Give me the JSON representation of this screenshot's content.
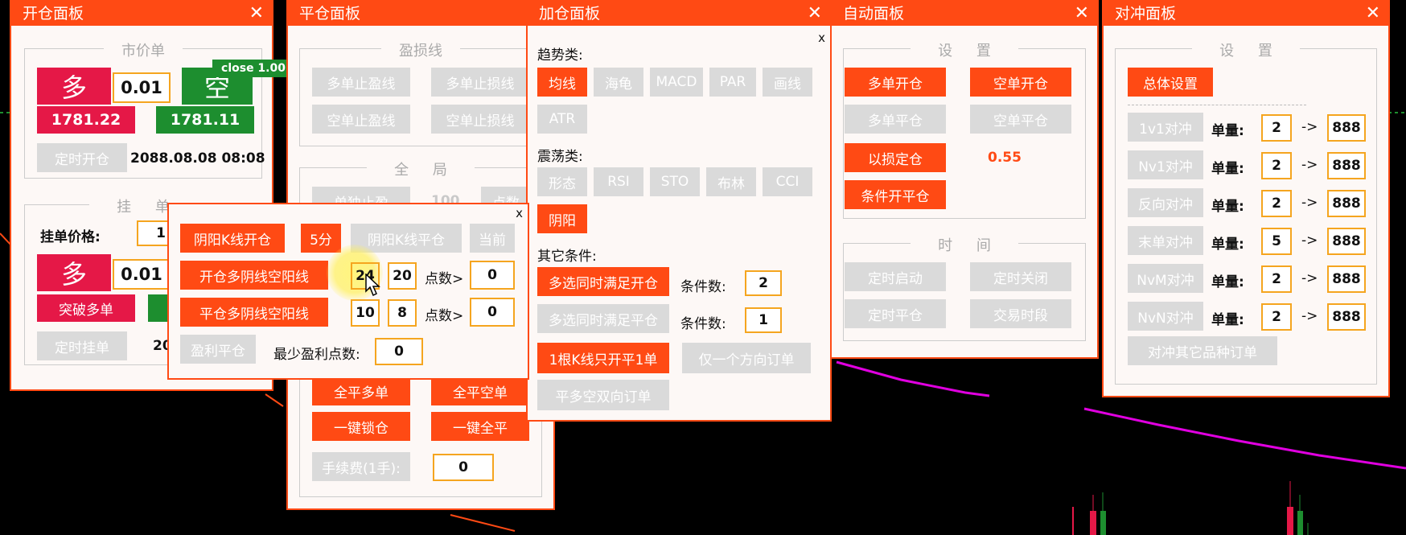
{
  "colors": {
    "accent": "#ff4a14",
    "buy_red": "#e51847",
    "sell_green": "#1d8e2f",
    "disabled_gray": "#dadada",
    "ma_line": "#e000e0"
  },
  "chart_overlay": {
    "close_label": "close 1.00"
  },
  "open_panel": {
    "title": "开仓面板",
    "close_icon": "✕",
    "market_group": "市价单",
    "buy_label": "多",
    "lot_value": "0.01",
    "sell_label": "空",
    "bid_price": "1781.22",
    "ask_price": "1781.11",
    "timed_open_label": "定时开仓",
    "timed_open_value": "2088.08.08 08:08",
    "pending_group": "挂 单",
    "pending_price_label": "挂单价格:",
    "pending_price_value": "1",
    "pending_buy_label": "多",
    "pending_lot_value": "0.01",
    "breakout_buy_label": "突破多单",
    "timed_pending_label": "定时挂单",
    "timed_pending_value": "208"
  },
  "close_panel": {
    "title": "平仓面板",
    "close_icon": "✕",
    "sltp_group": "盈损线",
    "buttons_sltp": [
      "多单止盈线",
      "多单止损线",
      "空单止盈线",
      "空单止损线"
    ],
    "global_group": "全 局",
    "partial_label": "单独止盈",
    "partial_value": "100",
    "points_label": "点数",
    "close_all_buy": "全平多单",
    "close_all_sell": "全平空单",
    "lock_label": "一键锁仓",
    "close_all": "一键全平",
    "fee_label": "手续费(1手):",
    "fee_value": "0"
  },
  "yinyang_popup": {
    "close_icon": "x",
    "open_label": "阴阳K线开仓",
    "timeframe": "5分",
    "close_label": "阴阳K线平仓",
    "current_label": "当前",
    "open_buy_label": "开仓多阴线空阳线",
    "open_v1": "24",
    "open_v2": "20",
    "points_label": "点数>",
    "open_points": "0",
    "close_buy_label": "平仓多阴线空阳线",
    "close_v1": "10",
    "close_v2": "8",
    "close_points": "0",
    "profit_close_label": "盈利平仓",
    "min_profit_label": "最少盈利点数:",
    "min_profit_value": "0"
  },
  "add_panel": {
    "title": "加仓面板",
    "close_icon": "✕",
    "inner_close": "x",
    "trend_label": "趋势类:",
    "trend_items": [
      {
        "label": "均线",
        "active": true
      },
      {
        "label": "海龟",
        "active": false
      },
      {
        "label": "MACD",
        "active": false
      },
      {
        "label": "PAR",
        "active": false
      },
      {
        "label": "画线",
        "active": false
      },
      {
        "label": "ATR",
        "active": false
      }
    ],
    "osc_label": "震荡类:",
    "osc_items": [
      {
        "label": "形态",
        "active": false
      },
      {
        "label": "RSI",
        "active": false
      },
      {
        "label": "STO",
        "active": false
      },
      {
        "label": "布林",
        "active": false
      },
      {
        "label": "CCI",
        "active": false
      },
      {
        "label": "阴阳",
        "active": true
      }
    ],
    "other_label": "其它条件:",
    "multi_open_label": "多选同时满足开仓",
    "cond_count_label": "条件数:",
    "cond_open_value": "2",
    "multi_close_label": "多选同时满足平仓",
    "cond_close_value": "1",
    "one_bar_label": "1根K线只开平1单",
    "one_dir_label": "仅一个方向订单",
    "close_both_label": "平多空双向订单"
  },
  "auto_panel": {
    "title": "自动面板",
    "close_icon": "✕",
    "settings_group": "设 置",
    "buy_open": "多单开仓",
    "sell_open": "空单开仓",
    "buy_close": "多单平仓",
    "sell_close": "空单平仓",
    "loss_sizing": "以损定仓",
    "loss_value": "0.55",
    "cond_open_close": "条件开平仓",
    "time_group": "时 间",
    "timed_start": "定时启动",
    "timed_stop": "定时关闭",
    "timed_close": "定时平仓",
    "session": "交易时段"
  },
  "hedge_panel": {
    "title": "对冲面板",
    "close_icon": "✕",
    "settings_group": "设 置",
    "overall_settings": "总体设置",
    "lot_label": "单量:",
    "arrow": "->",
    "rows": [
      {
        "label": "1v1对冲",
        "lot": "2",
        "target": "888"
      },
      {
        "label": "Nv1对冲",
        "lot": "2",
        "target": "888"
      },
      {
        "label": "反向对冲",
        "lot": "2",
        "target": "888"
      },
      {
        "label": "末单对冲",
        "lot": "5",
        "target": "888"
      },
      {
        "label": "NvM对冲",
        "lot": "2",
        "target": "888"
      },
      {
        "label": "NvN对冲",
        "lot": "2",
        "target": "888"
      }
    ],
    "hedge_other": "对冲其它品种订单"
  }
}
